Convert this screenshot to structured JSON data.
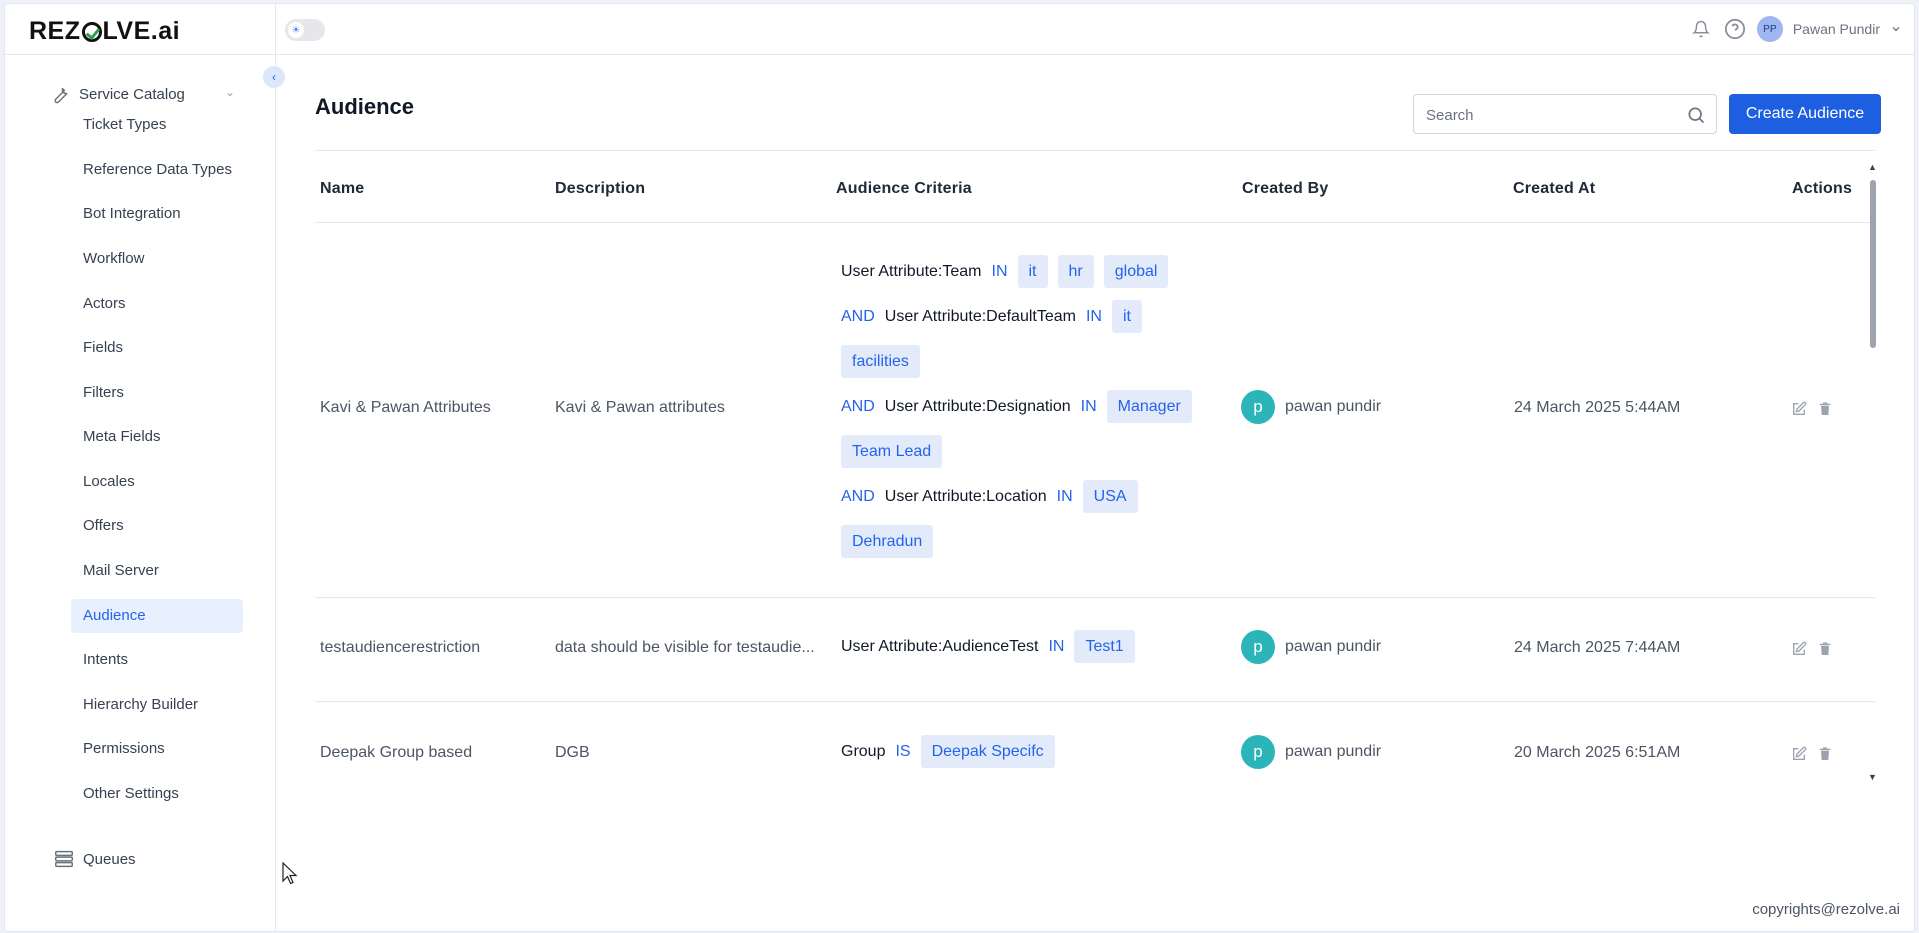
{
  "brand": {
    "logo_prefix": "REZ",
    "logo_mid": "LVE",
    "logo_suffix": ".ai"
  },
  "topbar": {
    "user_initials": "PP",
    "user_name": "Pawan Pundir"
  },
  "sidebar": {
    "section_label": "Service Catalog",
    "items": [
      {
        "label": "Ticket Types"
      },
      {
        "label": "Reference Data Types"
      },
      {
        "label": "Bot Integration"
      },
      {
        "label": "Workflow"
      },
      {
        "label": "Actors"
      },
      {
        "label": "Fields"
      },
      {
        "label": "Filters"
      },
      {
        "label": "Meta Fields"
      },
      {
        "label": "Locales"
      },
      {
        "label": "Offers"
      },
      {
        "label": "Mail Server"
      },
      {
        "label": "Audience",
        "active": true
      },
      {
        "label": "Intents"
      },
      {
        "label": "Hierarchy Builder"
      },
      {
        "label": "Permissions"
      },
      {
        "label": "Other Settings"
      }
    ],
    "queues_label": "Queues"
  },
  "page": {
    "title": "Audience",
    "search_placeholder": "Search",
    "create_button": "Create Audience"
  },
  "table": {
    "columns": [
      "Name",
      "Description",
      "Audience Criteria",
      "Created By",
      "Created At",
      "Actions"
    ],
    "rows": [
      {
        "name": "Kavi & Pawan Attributes",
        "description": "Kavi & Pawan attributes",
        "criteria": [
          {
            "conj": "",
            "attr": "User Attribute:Team",
            "op": "IN",
            "values": [
              "it",
              "hr",
              "global"
            ]
          },
          {
            "conj": "AND",
            "attr": "User Attribute:DefaultTeam",
            "op": "IN",
            "values": [
              "it"
            ]
          },
          {
            "conj": "",
            "attr": "",
            "op": "",
            "values": [
              "facilities"
            ]
          },
          {
            "conj": "AND",
            "attr": "User Attribute:Designation",
            "op": "IN",
            "values": [
              "Manager"
            ]
          },
          {
            "conj": "",
            "attr": "",
            "op": "",
            "values": [
              "Team Lead"
            ]
          },
          {
            "conj": "AND",
            "attr": "User Attribute:Location",
            "op": "IN",
            "values": [
              "USA"
            ]
          },
          {
            "conj": "",
            "attr": "",
            "op": "",
            "values": [
              "Dehradun"
            ]
          }
        ],
        "creator_initial": "p",
        "created_by": "pawan pundir",
        "created_at": "24 March 2025 5:44AM"
      },
      {
        "name": "testaudiencerestriction",
        "description": "data should be visible for testaudie...",
        "criteria": [
          {
            "conj": "",
            "attr": "User Attribute:AudienceTest",
            "op": "IN",
            "values": [
              "Test1"
            ]
          }
        ],
        "creator_initial": "p",
        "created_by": "pawan pundir",
        "created_at": "24 March 2025 7:44AM"
      },
      {
        "name": "Deepak Group based",
        "description": "DGB",
        "criteria": [
          {
            "conj": "",
            "attr": "Group",
            "op": "IS",
            "values": [
              "Deepak Specifc"
            ]
          }
        ],
        "creator_initial": "p",
        "created_by": "pawan pundir",
        "created_at": "20 March 2025 6:51AM"
      }
    ]
  },
  "footer": {
    "copyright": "copyrights@rezolve.ai"
  },
  "colors": {
    "accent": "#1d5fe0",
    "chip_bg": "#e3ebfb",
    "chip_text": "#2563eb",
    "avatar": "#2bb5b8"
  }
}
